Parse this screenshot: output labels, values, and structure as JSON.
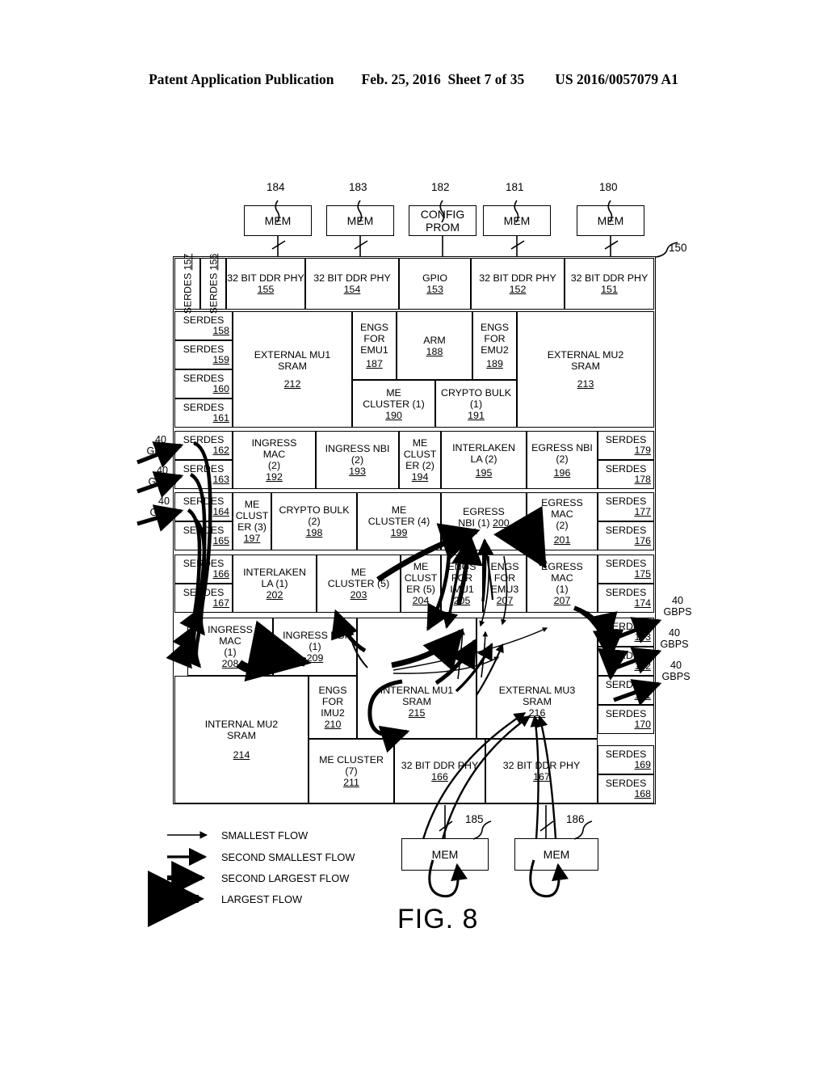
{
  "header": {
    "left": "Patent Application Publication",
    "date": "Feb. 25, 2016",
    "sheet": "Sheet 7 of 35",
    "number": "US 2016/0057079 A1"
  },
  "figure": {
    "caption": "FIG. 8",
    "chip_ref": "150"
  },
  "top_memories": [
    {
      "label": "MEM",
      "ref": "184"
    },
    {
      "label": "MEM",
      "ref": "183"
    },
    {
      "label": "CONFIG\nPROM",
      "ref": "182"
    },
    {
      "label": "MEM",
      "ref": "181"
    },
    {
      "label": "MEM",
      "ref": "180"
    }
  ],
  "bottom_memories": [
    {
      "label": "MEM",
      "ref": "185"
    },
    {
      "label": "MEM",
      "ref": "186"
    }
  ],
  "top_row_blocks": [
    {
      "name": "32 BIT DDR PHY",
      "num": "155"
    },
    {
      "name": "32 BIT DDR PHY",
      "num": "154"
    },
    {
      "name": "GPIO",
      "num": "153"
    },
    {
      "name": "32 BIT DDR PHY",
      "num": "152"
    },
    {
      "name": "32 BIT DDR PHY",
      "num": "151"
    }
  ],
  "bottom_row_blocks": [
    {
      "name": "32 BIT DDR PHY",
      "num": "166"
    },
    {
      "name": "32 BIT DDR PHY",
      "num": "167"
    }
  ],
  "vertical_serdes": [
    {
      "name": "SERDES",
      "num": "157"
    },
    {
      "name": "SERDES",
      "num": "156"
    }
  ],
  "left_serdes": [
    {
      "name": "SERDES",
      "num": "158"
    },
    {
      "name": "SERDES",
      "num": "159"
    },
    {
      "name": "SERDES",
      "num": "160"
    },
    {
      "name": "SERDES",
      "num": "161"
    },
    {
      "name": "SERDES",
      "num": "162"
    },
    {
      "name": "SERDES",
      "num": "163"
    },
    {
      "name": "SERDES",
      "num": "164"
    },
    {
      "name": "SERDES",
      "num": "165"
    },
    {
      "name": "SERDES",
      "num": "166"
    },
    {
      "name": "SERDES",
      "num": "167"
    }
  ],
  "right_serdes": [
    {
      "name": "SERDES",
      "num": "179"
    },
    {
      "name": "SERDES",
      "num": "178"
    },
    {
      "name": "SERDES",
      "num": "177"
    },
    {
      "name": "SERDES",
      "num": "176"
    },
    {
      "name": "SERDES",
      "num": "175"
    },
    {
      "name": "SERDES",
      "num": "174"
    },
    {
      "name": "SERDES",
      "num": "173"
    },
    {
      "name": "SERDES",
      "num": "172"
    },
    {
      "name": "SERDES",
      "num": "171"
    },
    {
      "name": "SERDES",
      "num": "170"
    },
    {
      "name": "SERDES",
      "num": "169"
    },
    {
      "name": "SERDES",
      "num": "168"
    }
  ],
  "blocks": {
    "ext_mu1": {
      "l1": "EXTERNAL MU1",
      "l2": "SRAM",
      "num": "212"
    },
    "ext_mu2": {
      "l1": "EXTERNAL MU2",
      "l2": "SRAM",
      "num": "213"
    },
    "engs_emu1": {
      "l1": "ENGS",
      "l2": "FOR",
      "l3": "EMU1",
      "num": "187"
    },
    "arm": {
      "l1": "ARM",
      "num": "188"
    },
    "engs_emu2": {
      "l1": "ENGS",
      "l2": "FOR",
      "l3": "EMU2",
      "num": "189"
    },
    "me_cluster_1": {
      "l1": "ME",
      "l2": "CLUSTER (1)",
      "num": "190"
    },
    "crypto_bulk_1": {
      "l1": "CRYPTO BULK",
      "l2": "(1)",
      "num": "191"
    },
    "ingress_mac_2": {
      "l1": "INGRESS",
      "l2": "MAC",
      "l3": "(2)",
      "num": "192"
    },
    "ingress_nbi_2": {
      "l1": "INGRESS NBI",
      "l2": "(2)",
      "num": "193"
    },
    "me_cluster_2": {
      "l1": "ME",
      "l2": "CLUST",
      "l3": "ER (2)",
      "num": "194"
    },
    "interlaken_la_2": {
      "l1": "INTERLAKEN",
      "l2": "LA  (2)",
      "num": "195"
    },
    "egress_nbi_2": {
      "l1": "EGRESS NBI",
      "l2": "(2)",
      "num": "196"
    },
    "me_cluster_3": {
      "l1": "ME",
      "l2": "CLUST",
      "l3": "ER (3)",
      "num": "197"
    },
    "crypto_bulk_2": {
      "l1": "CRYPTO BULK",
      "l2": "(2)",
      "num": "198"
    },
    "me_cluster_4": {
      "l1": "ME",
      "l2": "CLUSTER (4)",
      "num": "199"
    },
    "egress_nbi_1": {
      "l1": "EGRESS",
      "l2": "NBI (1)",
      "num": "200"
    },
    "egress_mac_2": {
      "l1": "EGRESS",
      "l2": "MAC",
      "l3": "(2)",
      "num": "201"
    },
    "interlaken_la_1": {
      "l1": "INTERLAKEN",
      "l2": "LA (1)",
      "num": "202"
    },
    "me_cluster_5": {
      "l1": "ME",
      "l2": "CLUSTER (5)",
      "num": "203"
    },
    "me_cluster_5b": {
      "l1": "ME",
      "l2": "CLUST",
      "l3": "ER (5)",
      "num": "204"
    },
    "engs_imu1": {
      "l1": "ENGS",
      "l2": "FOR",
      "l3": "IMU1",
      "num": "205"
    },
    "engs_emu3": {
      "l1": "ENGS",
      "l2": "FOR",
      "l3": "EMU3",
      "num": "207"
    },
    "egress_mac_1": {
      "l1": "EGRESS",
      "l2": "MAC",
      "l3": "(1)",
      "num": "207"
    },
    "ingress_mac_1": {
      "l1": "INGRESS",
      "l2": "MAC",
      "l3": "(1)",
      "num": "208"
    },
    "ingress_nbi_1": {
      "l1": "INGRESS NBI",
      "l2": "(1)",
      "num": "209"
    },
    "engs_imu2": {
      "l1": "ENGS",
      "l2": "FOR",
      "l3": "IMU2",
      "num": "210"
    },
    "me_cluster_7": {
      "l1": "ME CLUSTER",
      "l2": "(7)",
      "num": "211"
    },
    "int_mu2": {
      "l1": "INTERNAL MU2",
      "l2": "SRAM",
      "num": "214"
    },
    "int_mu1": {
      "l1": "INTERNAL MU1",
      "l2": "SRAM",
      "num": "215"
    },
    "ext_mu3": {
      "l1": "EXTERNAL MU3",
      "l2": "SRAM",
      "num": "216"
    }
  },
  "throughput_labels": {
    "left": [
      "40\nGBPS",
      "40\nGBPS",
      "40\nGBPS"
    ],
    "right": [
      "40\nGBPS",
      "40\nGBPS",
      "40\nGBPS"
    ]
  },
  "legend": [
    {
      "label": "SMALLEST FLOW",
      "weight": 1.6
    },
    {
      "label": "SECOND SMALLEST FLOW",
      "weight": 3.2
    },
    {
      "label": "SECOND LARGEST FLOW",
      "weight": 6
    },
    {
      "label": "LARGEST FLOW",
      "weight": 10
    }
  ],
  "colors": {
    "ink": "#000000",
    "paper": "#ffffff"
  }
}
